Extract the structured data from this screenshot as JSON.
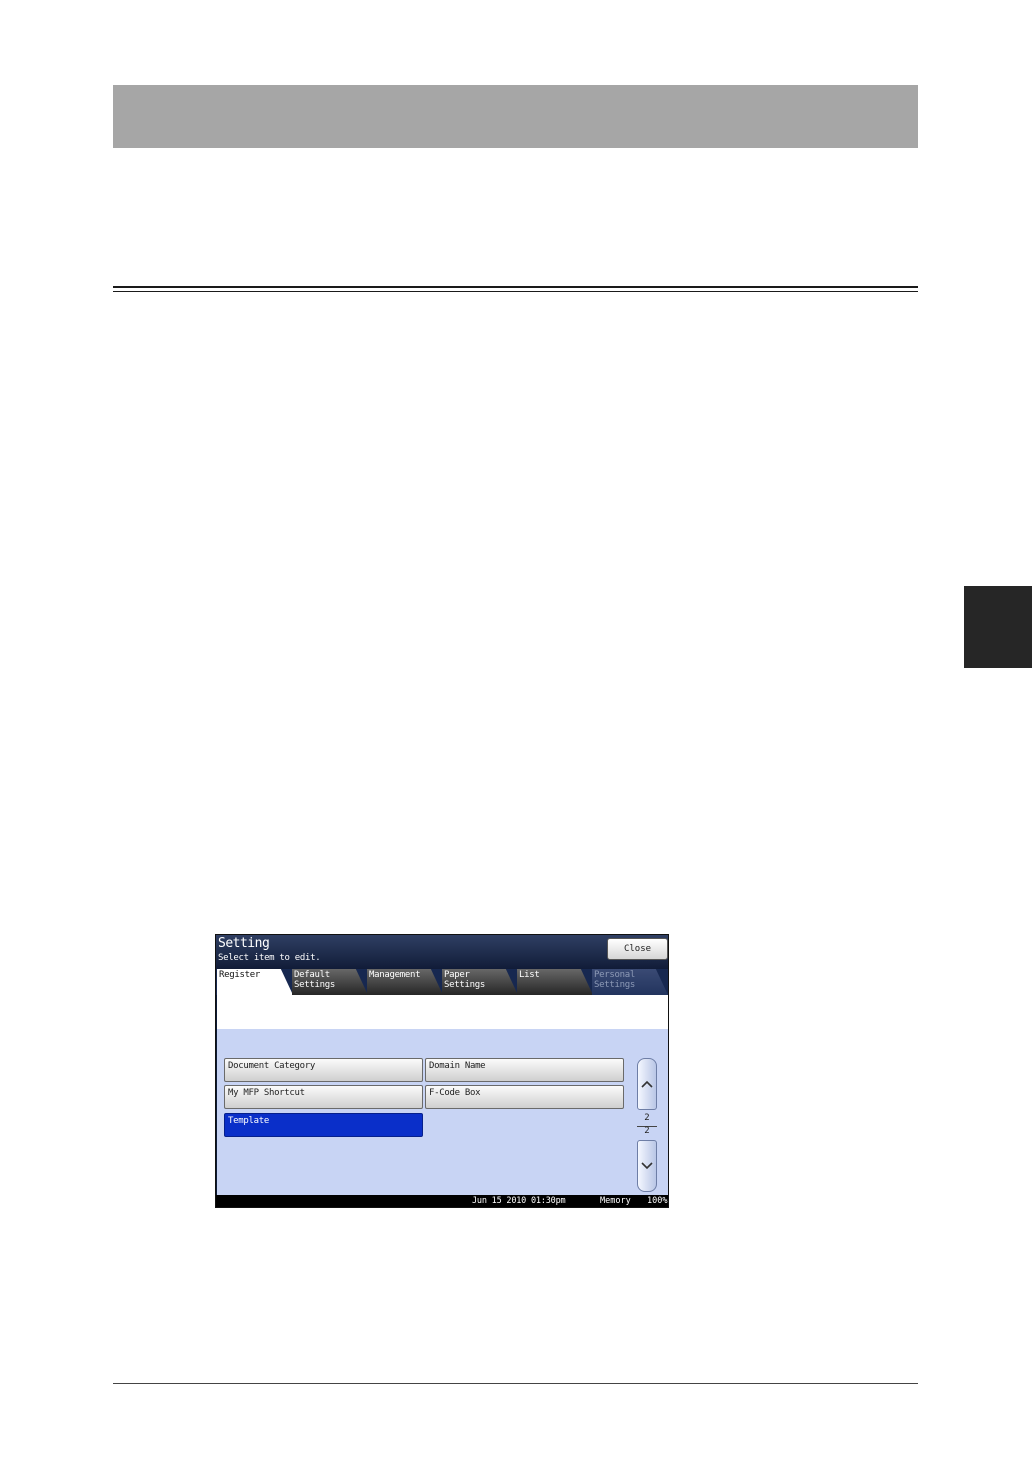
{
  "panel": {
    "title": "Setting",
    "subtitle": "Select item to edit.",
    "close_label": "Close",
    "tabs": [
      {
        "label": "Register"
      },
      {
        "label": "Default\nSettings"
      },
      {
        "label": "Management"
      },
      {
        "label": "Paper\nSettings"
      },
      {
        "label": "List"
      },
      {
        "label": "Personal\nSettings"
      }
    ],
    "items": [
      {
        "label": "Document Category"
      },
      {
        "label": "Domain Name"
      },
      {
        "label": "My MFP Shortcut"
      },
      {
        "label": "F-Code Box"
      },
      {
        "label": "Template"
      }
    ],
    "page_current": "2",
    "page_total": "2",
    "status": {
      "datetime": "Jun 15 2010 01:30pm",
      "memory_label": "Memory",
      "memory_value": "100%"
    }
  }
}
